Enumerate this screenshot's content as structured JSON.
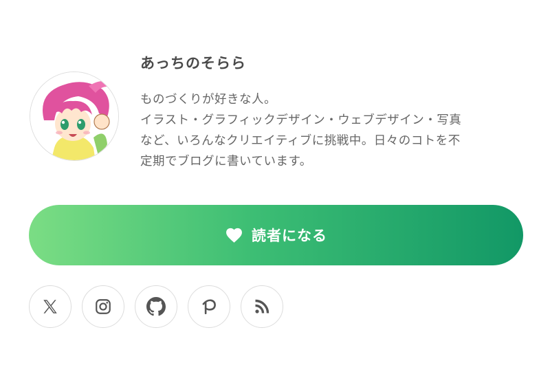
{
  "profile": {
    "name": "あっちのそらら",
    "bio_lines": [
      "ものづくりが好きな人。",
      "イラスト・グラフィックデザイン・ウェブデザイン・写真",
      "など、いろんなクリエイティブに挑戦中。日々のコトを不",
      "定期でブログに書いています。"
    ],
    "avatar_icon": "anime-character-avatar"
  },
  "subscribe": {
    "label": "読者になる",
    "icon": "heart-icon",
    "gradient_start": "#7bdd84",
    "gradient_end": "#129866"
  },
  "social_links": [
    {
      "name": "x-icon"
    },
    {
      "name": "instagram-icon"
    },
    {
      "name": "github-icon"
    },
    {
      "name": "pixiv-icon"
    },
    {
      "name": "rss-icon"
    }
  ],
  "colors": {
    "text": "#666666",
    "name_text": "#4a4a4a",
    "icon": "#555555",
    "border": "#dcdcdc"
  }
}
